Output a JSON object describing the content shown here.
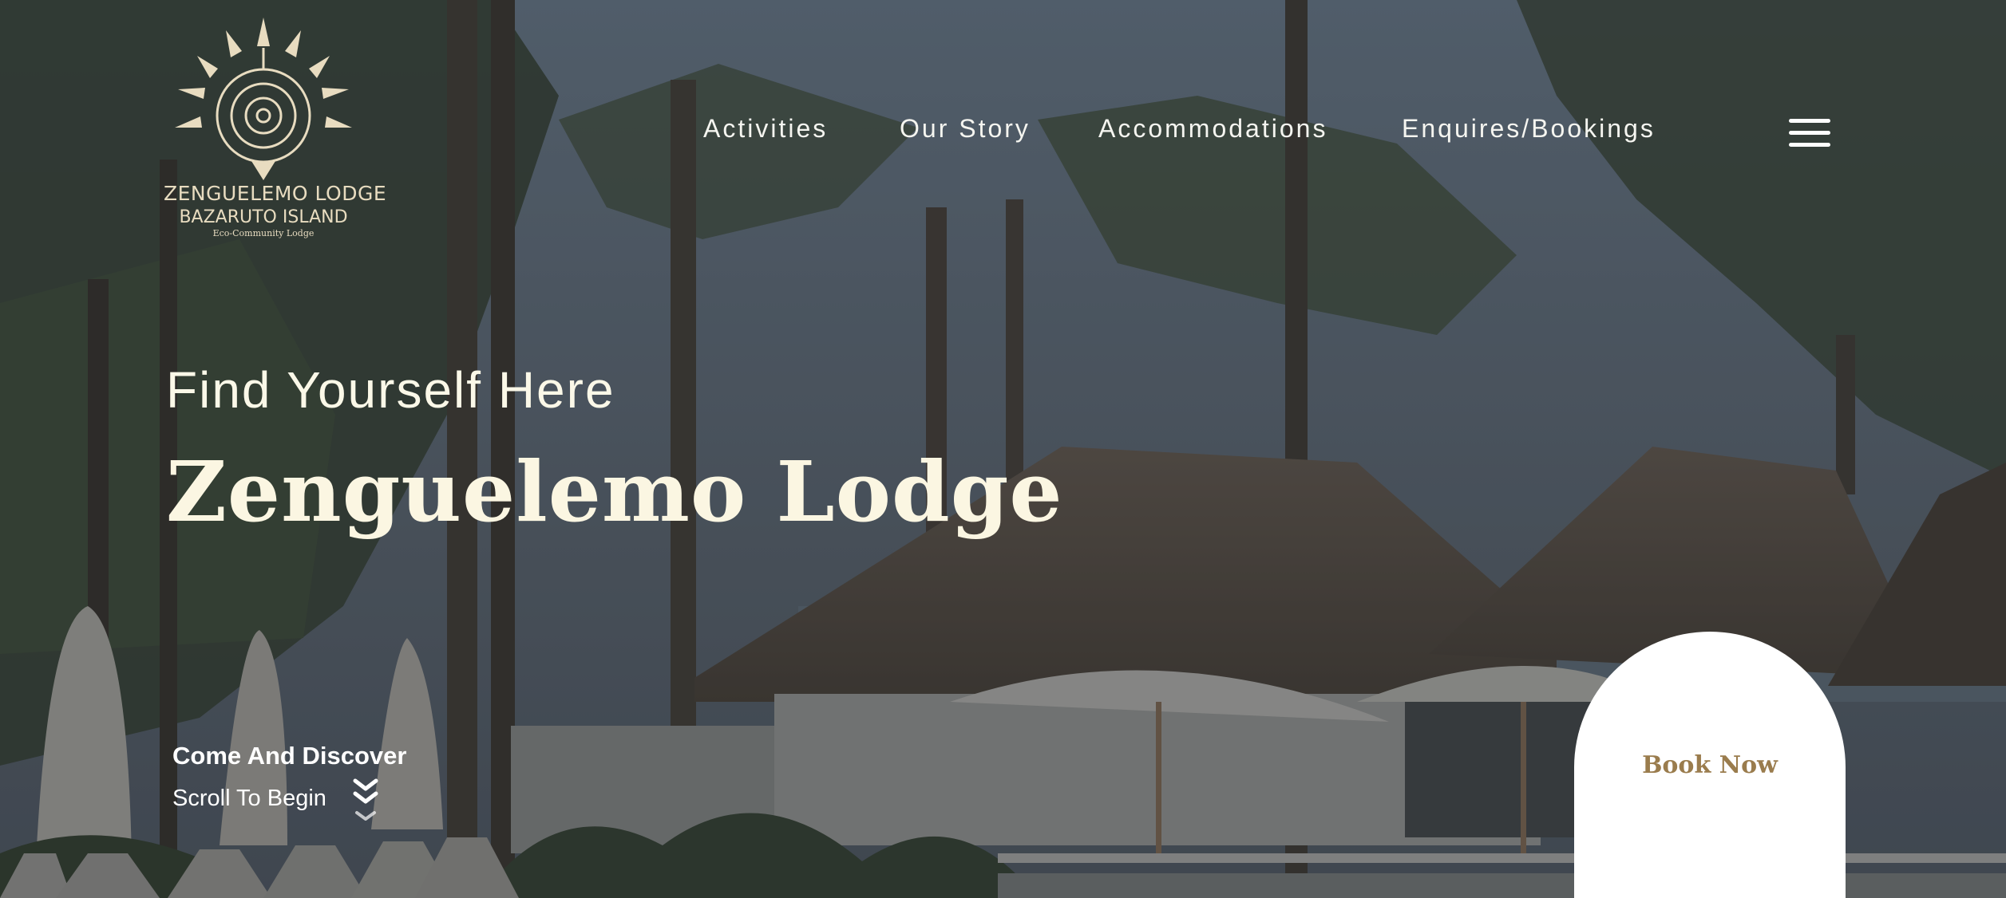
{
  "brand": {
    "line1": "ZENGUELEMO LODGE",
    "line2": "BAZARUTO ISLAND",
    "line3": "Eco-Community Lodge"
  },
  "nav": {
    "items": [
      "Activities",
      "Our Story",
      "Accommodations",
      "Enquires/Bookings"
    ]
  },
  "hero": {
    "subtitle": "Find Yourself Here",
    "title": "Zenguelemo Lodge",
    "discover": "Come And Discover",
    "scroll": "Scroll To Begin"
  },
  "cta": {
    "book": "Book Now"
  },
  "icons": {
    "menu": "hamburger-menu-icon",
    "scroll": "double-chevron-down-icon",
    "logo": "sun-turtle-logo"
  },
  "colors": {
    "overlay": "#3c4249",
    "text": "#fbf6e2",
    "accent": "#9a7c4d",
    "logo": "#e8dcc0"
  }
}
